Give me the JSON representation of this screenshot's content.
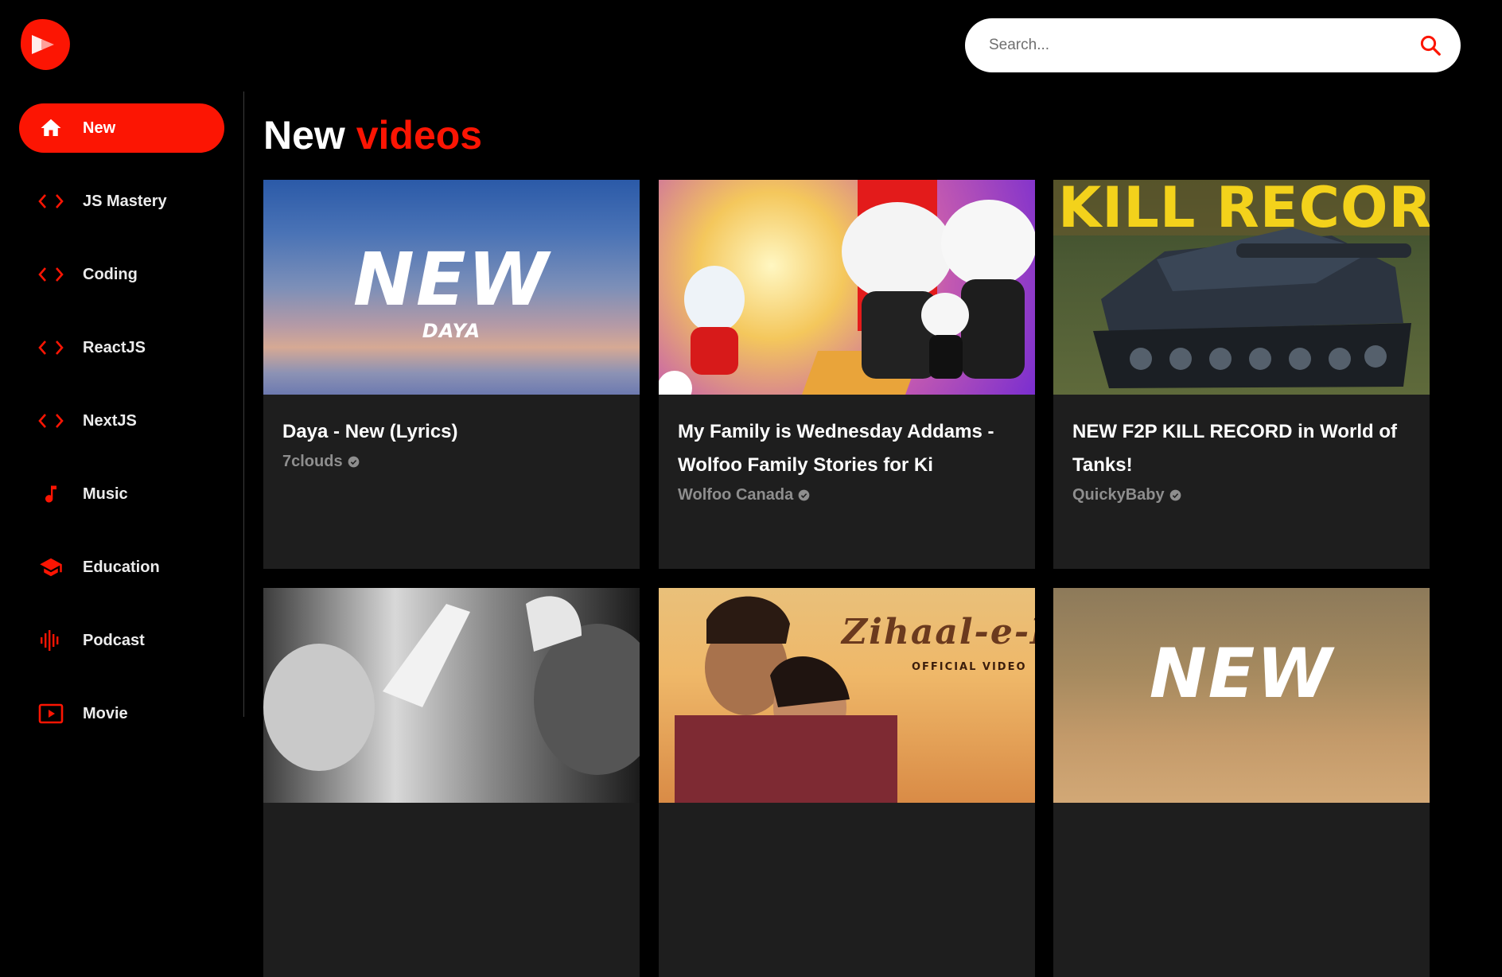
{
  "search": {
    "placeholder": "Search..."
  },
  "sidebar": {
    "items": [
      {
        "label": "New",
        "icon": "home-icon",
        "active": true
      },
      {
        "label": "JS Mastery",
        "icon": "code-icon"
      },
      {
        "label": "Coding",
        "icon": "code-icon"
      },
      {
        "label": "ReactJS",
        "icon": "code-icon"
      },
      {
        "label": "NextJS",
        "icon": "code-icon"
      },
      {
        "label": "Music",
        "icon": "music-note-icon"
      },
      {
        "label": "Education",
        "icon": "school-icon"
      },
      {
        "label": "Podcast",
        "icon": "podcast-icon"
      },
      {
        "label": "Movie",
        "icon": "video-play-icon"
      }
    ]
  },
  "main": {
    "title_prefix": "New",
    "title_accent": "videos",
    "videos": [
      {
        "title": "Daya - New (Lyrics)",
        "channel": "7clouds",
        "thumb_text": "NEW",
        "thumb_sub": "DAYA"
      },
      {
        "title": "My Family is Wednesday Addams - Wolfoo Family Stories for Ki",
        "channel": "Wolfoo Canada"
      },
      {
        "title": "NEW F2P KILL RECORD in World of Tanks!",
        "channel": "QuickyBaby",
        "thumb_text": "KILL RECOR"
      },
      {
        "title": "",
        "channel": ""
      },
      {
        "title": "",
        "channel": "",
        "thumb_text": "Zihaal-e-Mis",
        "thumb_sub": "OFFICIAL VIDEO"
      },
      {
        "title": "",
        "channel": "",
        "thumb_text": "NEW"
      }
    ]
  },
  "colors": {
    "accent": "#fc1503",
    "card_bg": "#1e1e1e",
    "background": "#000000"
  }
}
